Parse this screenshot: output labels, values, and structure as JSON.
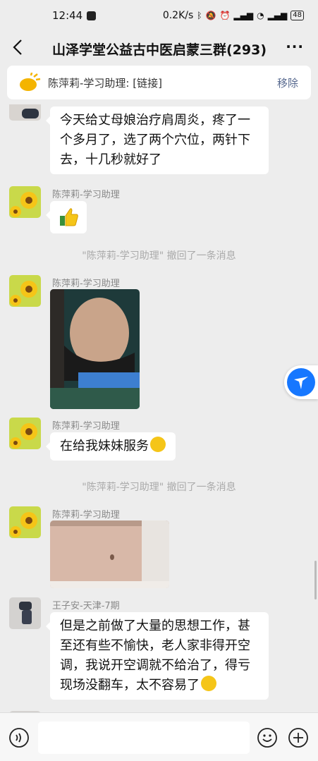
{
  "status": {
    "time": "12:44",
    "speed": "0.2K/s",
    "battery": "48"
  },
  "header": {
    "title": "山泽学堂公益古中医启蒙三群(293)",
    "more": "···"
  },
  "pinned": {
    "text": "陈萍莉-学习助理: [链接]",
    "remove_label": "移除"
  },
  "messages": {
    "m1": {
      "text_lines": [
        "今天给丈母娘治疗肩周炎，疼了一",
        "个多月了，选了两个穴位，两针下",
        "去，十几秒就好了"
      ]
    },
    "m2": {
      "sender": "陈萍莉-学习助理"
    },
    "sys1": {
      "text": "\"陈萍莉-学习助理\" 撤回了一条消息"
    },
    "m3": {
      "sender": "陈萍莉-学习助理"
    },
    "m4": {
      "sender": "陈萍莉-学习助理",
      "text": "在给我妹妹服务"
    },
    "sys2": {
      "text": "\"陈萍莉-学习助理\" 撤回了一条消息"
    },
    "m5": {
      "sender": "陈萍莉-学习助理"
    },
    "m6": {
      "sender": "王子安-天津-7期",
      "text_lines": [
        "但是之前做了大量的思想工作，甚",
        "至还有些不愉快，老人家非得开空",
        "调，我说开空调就不给治了，得亏",
        "现场没翻车，太不容易了"
      ]
    }
  },
  "input": {
    "placeholder": ""
  },
  "colors": {
    "background": "#ededed",
    "link_blue": "#57698f",
    "float_button": "#1677ff"
  }
}
